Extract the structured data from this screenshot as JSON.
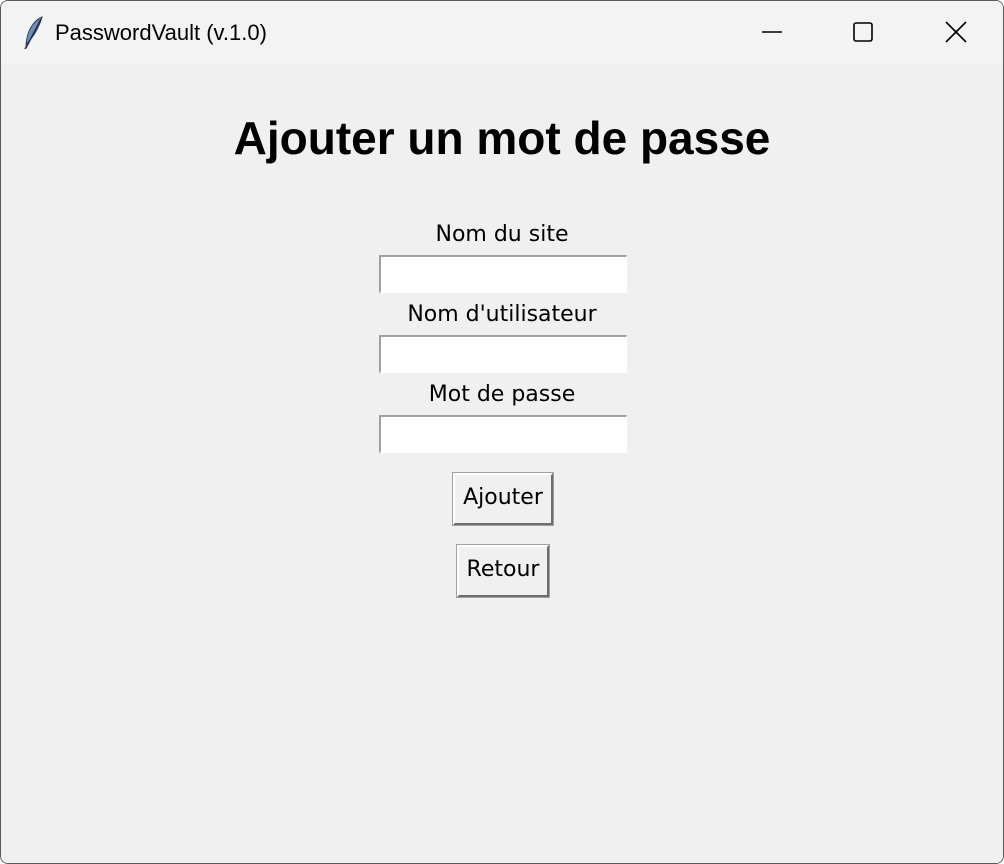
{
  "window": {
    "title": "PasswordVault (v.1.0)",
    "app_icon": "feather-icon",
    "controls": [
      "minimize-icon",
      "maximize-icon",
      "close-icon"
    ]
  },
  "form": {
    "heading": "Ajouter un mot de passe",
    "fields": [
      {
        "label": "Nom du site",
        "value": "",
        "placeholder": ""
      },
      {
        "label": "Nom d'utilisateur",
        "value": "",
        "placeholder": ""
      },
      {
        "label": "Mot de passe",
        "value": "",
        "placeholder": ""
      }
    ],
    "add_button": "Ajouter",
    "back_button": "Retour"
  },
  "colors": {
    "background": "#f0f0f0",
    "titlebar": "#f3f3f3",
    "entry_background": "#ffffff",
    "text": "#000000"
  }
}
